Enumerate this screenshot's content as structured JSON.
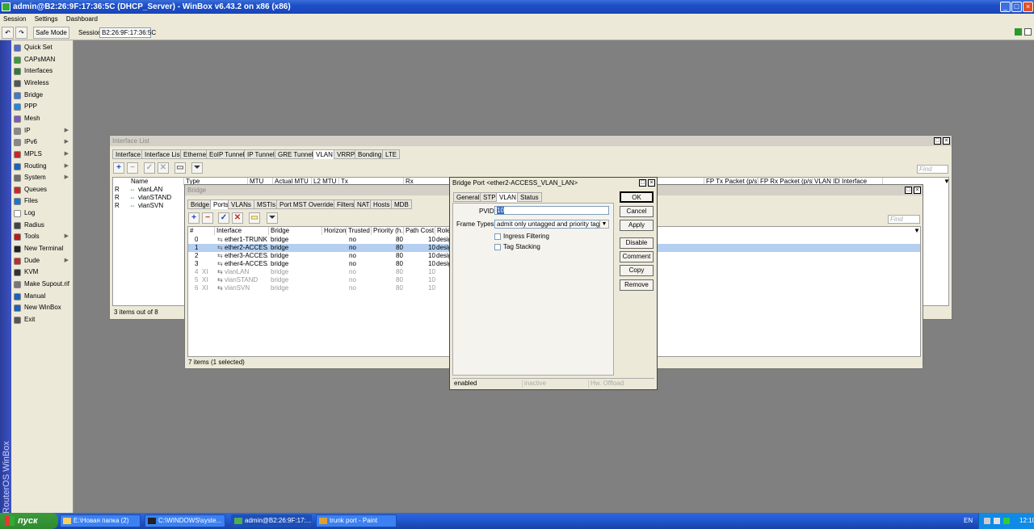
{
  "window": {
    "title": "admin@B2:26:9F:17:36:5C (DHCP_Server) - WinBox v6.43.2 on x86 (x86)"
  },
  "menu": [
    "Session",
    "Settings",
    "Dashboard"
  ],
  "toolbar": {
    "safe_mode": "Safe Mode",
    "session_label": "Session:",
    "session_value": "B2:26:9F:17:36:5C"
  },
  "sidebar": {
    "brand": "RouterOS WinBox",
    "items": [
      {
        "label": "Quick Set",
        "icon": "quick-set-icon",
        "color": "#4b6bd0",
        "sub": false
      },
      {
        "label": "CAPsMAN",
        "icon": "capsman-icon",
        "color": "#3a9a3a",
        "sub": false
      },
      {
        "label": "Interfaces",
        "icon": "interfaces-icon",
        "color": "#2e7d32",
        "sub": false
      },
      {
        "label": "Wireless",
        "icon": "wireless-icon",
        "color": "#555555",
        "sub": false
      },
      {
        "label": "Bridge",
        "icon": "bridge-icon",
        "color": "#3a7bd5",
        "sub": false
      },
      {
        "label": "PPP",
        "icon": "ppp-icon",
        "color": "#1e88e5",
        "sub": false
      },
      {
        "label": "Mesh",
        "icon": "mesh-icon",
        "color": "#7e57c2",
        "sub": false
      },
      {
        "label": "IP",
        "icon": "ip-icon",
        "color": "#888888",
        "sub": true
      },
      {
        "label": "IPv6",
        "icon": "ipv6-icon",
        "color": "#888888",
        "sub": true
      },
      {
        "label": "MPLS",
        "icon": "mpls-icon",
        "color": "#c62828",
        "sub": true
      },
      {
        "label": "Routing",
        "icon": "routing-icon",
        "color": "#1565c0",
        "sub": true
      },
      {
        "label": "System",
        "icon": "system-icon",
        "color": "#6d6d6d",
        "sub": true
      },
      {
        "label": "Queues",
        "icon": "queues-icon",
        "color": "#c62828",
        "sub": false
      },
      {
        "label": "Files",
        "icon": "files-icon",
        "color": "#1976d2",
        "sub": false
      },
      {
        "label": "Log",
        "icon": "log-icon",
        "color": "#ffffff",
        "sub": false
      },
      {
        "label": "Radius",
        "icon": "radius-icon",
        "color": "#444444",
        "sub": false
      },
      {
        "label": "Tools",
        "icon": "tools-icon",
        "color": "#b71c1c",
        "sub": true
      },
      {
        "label": "New Terminal",
        "icon": "terminal-icon",
        "color": "#222222",
        "sub": false
      },
      {
        "label": "Dude",
        "icon": "dude-icon",
        "color": "#c62828",
        "sub": true
      },
      {
        "label": "KVM",
        "icon": "kvm-icon",
        "color": "#333333",
        "sub": false
      },
      {
        "label": "Make Supout.rif",
        "icon": "supout-icon",
        "color": "#777777",
        "sub": false
      },
      {
        "label": "Manual",
        "icon": "manual-icon",
        "color": "#1565c0",
        "sub": false
      },
      {
        "label": "New WinBox",
        "icon": "winbox-icon",
        "color": "#1565c0",
        "sub": false
      },
      {
        "label": "Exit",
        "icon": "exit-icon",
        "color": "#555555",
        "sub": false
      }
    ]
  },
  "interface_list": {
    "title": "Interface List",
    "tabs": [
      "Interface",
      "Interface List",
      "Ethernet",
      "EoIP Tunnel",
      "IP Tunnel",
      "GRE Tunnel",
      "VLAN",
      "VRRP",
      "Bonding",
      "LTE"
    ],
    "find": "Find",
    "columns": [
      "Name",
      "Type",
      "MTU",
      "Actual MTU",
      "L2 MTU",
      "Tx",
      "Rx",
      "FP Tx Packet (p/s)",
      "FP Rx Packet (p/s)",
      "VLAN ID",
      "Interface"
    ],
    "rows": [
      {
        "flag": "R",
        "name": "vlanLAN"
      },
      {
        "flag": "R",
        "name": "vlanSTAND"
      },
      {
        "flag": "R",
        "name": "vlanSVN"
      }
    ],
    "status": "3 items out of 8"
  },
  "bridge": {
    "title": "Bridge",
    "tabs": [
      "Bridge",
      "Ports",
      "VLANs",
      "MSTIs",
      "Port MST Overrides",
      "Filters",
      "NAT",
      "Hosts",
      "MDB"
    ],
    "find": "Find",
    "columns": [
      "#",
      "Interface",
      "Bridge",
      "Horizon",
      "Trusted",
      "Priority (h...",
      "Path Cost",
      "Role"
    ],
    "rows": [
      {
        "num": "0",
        "flag": "",
        "iface": "ether1-TRUNK",
        "bridge": "bridge",
        "trusted": "no",
        "priority": "80",
        "cost": "10",
        "role": "desig",
        "sel": false,
        "dis": false
      },
      {
        "num": "1",
        "flag": "",
        "iface": "ether2-ACCES...",
        "bridge": "bridge",
        "trusted": "no",
        "priority": "80",
        "cost": "10",
        "role": "desig",
        "sel": true,
        "dis": false
      },
      {
        "num": "2",
        "flag": "",
        "iface": "ether3-ACCES...",
        "bridge": "bridge",
        "trusted": "no",
        "priority": "80",
        "cost": "10",
        "role": "desig",
        "sel": false,
        "dis": false
      },
      {
        "num": "3",
        "flag": "",
        "iface": "ether4-ACCES...",
        "bridge": "bridge",
        "trusted": "no",
        "priority": "80",
        "cost": "10",
        "role": "desig",
        "sel": false,
        "dis": false
      },
      {
        "num": "4",
        "flag": "XI",
        "iface": "vlanLAN",
        "bridge": "bridge",
        "trusted": "no",
        "priority": "80",
        "cost": "10",
        "role": "",
        "sel": false,
        "dis": true
      },
      {
        "num": "5",
        "flag": "XI",
        "iface": "vlanSTAND",
        "bridge": "bridge",
        "trusted": "no",
        "priority": "80",
        "cost": "10",
        "role": "",
        "sel": false,
        "dis": true
      },
      {
        "num": "6",
        "flag": "XI",
        "iface": "vlanSVN",
        "bridge": "bridge",
        "trusted": "no",
        "priority": "80",
        "cost": "10",
        "role": "",
        "sel": false,
        "dis": true
      }
    ],
    "status": "7 items (1 selected)"
  },
  "dialog": {
    "title": "Bridge Port <ether2-ACCESS_VLAN_LAN>",
    "tabs": [
      "General",
      "STP",
      "VLAN",
      "Status"
    ],
    "pvid_label": "PVID:",
    "pvid_value": "10",
    "frame_types_label": "Frame Types:",
    "frame_types_value": "admit only untagged and priority tagged",
    "ingress_filtering": "Ingress Filtering",
    "tag_stacking": "Tag Stacking",
    "buttons": [
      "OK",
      "Cancel",
      "Apply",
      "Disable",
      "Comment",
      "Copy",
      "Remove"
    ],
    "status": [
      "enabled",
      "inactive",
      "Hw. Offload"
    ]
  },
  "taskbar": {
    "start": "пуск",
    "tasks": [
      "E:\\Новая папка (2)",
      "C:\\WINDOWS\\syste...",
      "admin@B2:26:9F:17:...",
      "trunk port - Paint"
    ],
    "lang": "EN",
    "clock": "12:10"
  }
}
